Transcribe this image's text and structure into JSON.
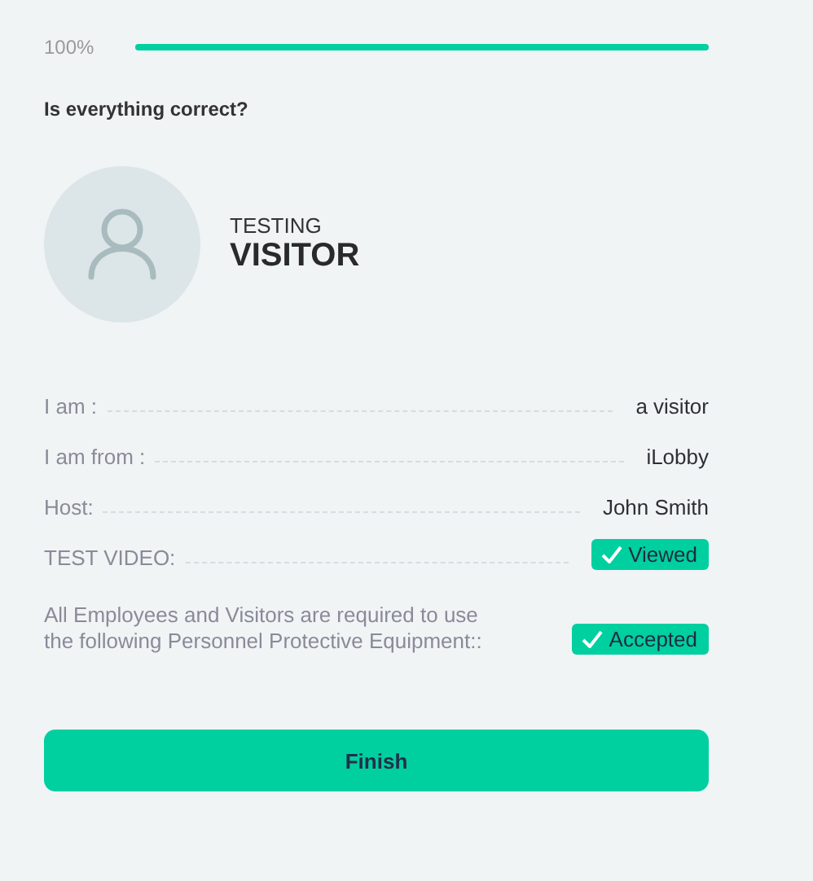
{
  "progress": {
    "label": "100%",
    "level": 1
  },
  "question": "Is everything correct?",
  "profile": {
    "subtitle": "TESTING",
    "title": "VISITOR"
  },
  "details": [
    {
      "kind": "text",
      "label": "I am :",
      "value": "a visitor"
    },
    {
      "kind": "text",
      "label": "I am from :",
      "value": "iLobby"
    },
    {
      "kind": "text",
      "label": "Host:",
      "value": "John Smith"
    },
    {
      "kind": "badge",
      "label": "TEST VIDEO:",
      "value": "Viewed"
    },
    {
      "kind": "note",
      "label": "All Employees and Visitors are required to use the following Personnel Protective Equipment::",
      "value": "Accepted"
    }
  ],
  "buttons": [
    "Finish"
  ]
}
